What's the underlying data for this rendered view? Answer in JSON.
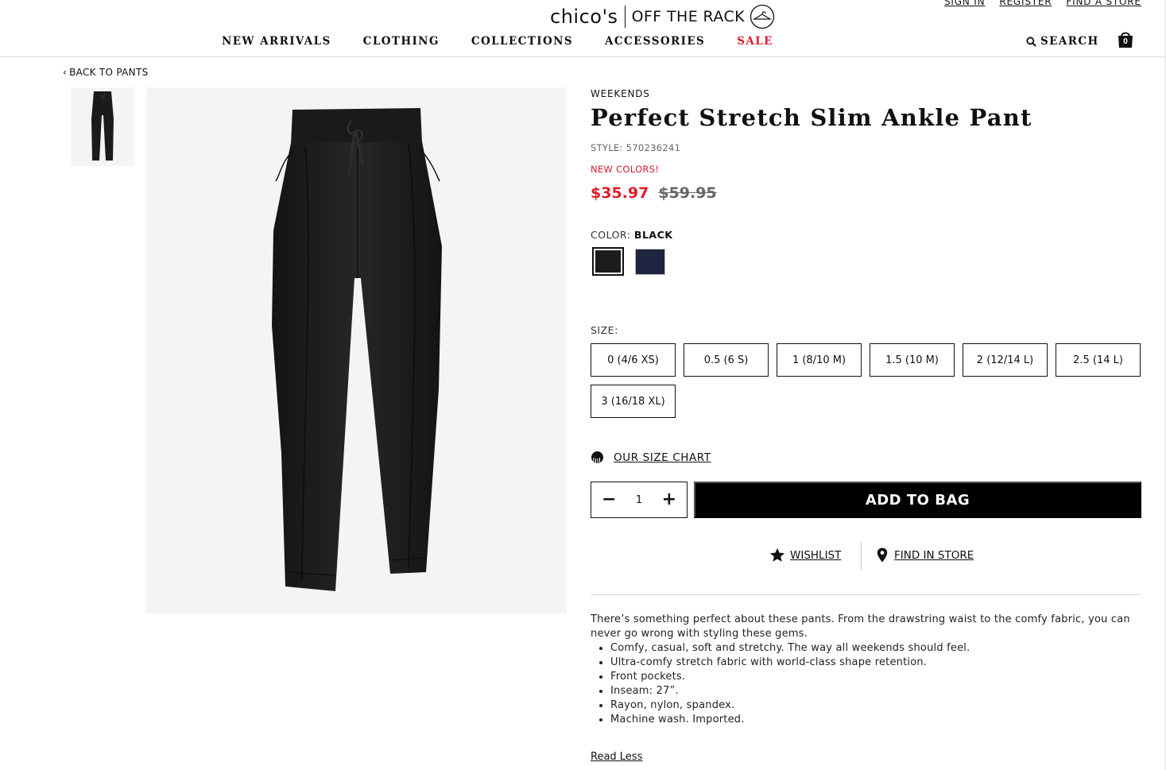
{
  "header": {
    "logo_primary": "chico's",
    "logo_secondary": "OFF THE RACK",
    "util_links": [
      "SIGN IN",
      "REGISTER",
      "FIND A STORE"
    ],
    "nav": [
      "NEW ARRIVALS",
      "CLOTHING",
      "COLLECTIONS",
      "ACCESSORIES",
      "SALE"
    ],
    "search_label": "SEARCH",
    "bag_count": "0",
    "sale_color": "#e21d2a"
  },
  "breadcrumb": {
    "back_label": "BACK TO PANTS"
  },
  "product": {
    "brand": "WEEKENDS",
    "title": "Perfect Stretch Slim Ankle Pant",
    "style": "STYLE: 570236241",
    "badge": "NEW COLORS!",
    "price_sale": "$35.97",
    "price_original": "$59.95",
    "color_label": "COLOR:",
    "color_selected": "BLACK",
    "swatches": [
      {
        "name": "Black",
        "hex": "#1c1c1c",
        "selected": true
      },
      {
        "name": "Navy",
        "hex": "#1f2540",
        "selected": false
      }
    ],
    "size_label": "SIZE:",
    "sizes": [
      "0 (4/6 XS)",
      "0.5 (6 S)",
      "1 (8/10 M)",
      "1.5 (10 M)",
      "2 (12/14 L)",
      "2.5 (14 L)",
      "3 (16/18 XL)"
    ],
    "size_chart_label": "OUR SIZE CHART",
    "quantity": "1",
    "add_to_bag_label": "ADD TO BAG",
    "wishlist_label": "WISHLIST",
    "find_in_store_label": "FIND IN STORE",
    "description": "There’s something perfect about these pants. From the drawstring waist to the comfy fabric, you can never go wrong with styling these gems.",
    "bullets": [
      "Comfy, casual, soft and stretchy. The way all weekends should feel.",
      "Ultra-comfy stretch fabric with world-class shape retention.",
      "Front pockets.",
      "Inseam: 27”.",
      "Rayon, nylon, spandex.",
      "Machine wash. Imported."
    ],
    "read_less_label": "Read Less"
  }
}
